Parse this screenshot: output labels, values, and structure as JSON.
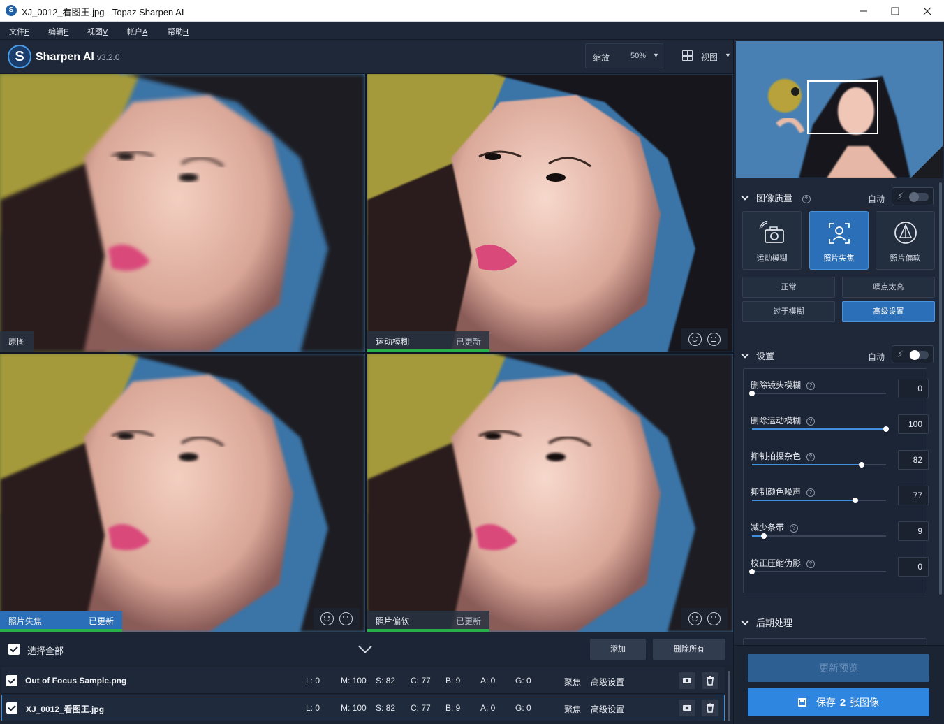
{
  "window": {
    "title": "XJ_0012_看图王.jpg - Topaz Sharpen AI"
  },
  "menu": [
    {
      "label": "文件",
      "key": "F"
    },
    {
      "label": "编辑",
      "key": "E"
    },
    {
      "label": "视图",
      "key": "V"
    },
    {
      "label": "帐户",
      "key": "A"
    },
    {
      "label": "帮助",
      "key": "H"
    }
  ],
  "brand": {
    "name": "Sharpen AI",
    "version": "v3.2.0"
  },
  "toolbar": {
    "zoom_label": "缩放",
    "zoom_value": "50%",
    "view_label": "视图"
  },
  "panes": {
    "original": "原图",
    "motion": {
      "label": "运动模糊",
      "status": "已更新"
    },
    "focus": {
      "label": "照片失焦",
      "status": "已更新"
    },
    "soft": {
      "label": "照片偏软",
      "status": "已更新"
    }
  },
  "queue": {
    "select_all": "选择全部",
    "add": "添加",
    "remove_all": "删除所有"
  },
  "files": [
    {
      "name": "Out of Focus Sample.png",
      "L": "L: 0",
      "M": "M: 100",
      "S": "S: 82",
      "C": "C: 77",
      "B": "B: 9",
      "A": "A: 0",
      "G": "G: 0",
      "mode": "聚焦",
      "preset": "高级设置"
    },
    {
      "name": "XJ_0012_看图王.jpg",
      "L": "L: 0",
      "M": "M: 100",
      "S": "S: 82",
      "C": "C: 77",
      "B": "B: 9",
      "A": "A: 0",
      "G": "G: 0",
      "mode": "聚焦",
      "preset": "高级设置"
    }
  ],
  "quality": {
    "title": "图像质量",
    "auto": "自动",
    "modes": [
      "运动模糊",
      "照片失焦",
      "照片偏软"
    ],
    "active_mode": "照片失焦",
    "types": [
      "正常",
      "噪点太高",
      "过于模糊",
      "高级设置"
    ],
    "active_type": "高级设置"
  },
  "settings": {
    "title": "设置",
    "auto": "自动",
    "sliders": [
      {
        "name": "删除镜头模糊",
        "value": 0,
        "display": "0"
      },
      {
        "name": "删除运动模糊",
        "value": 100,
        "display": "100"
      },
      {
        "name": "抑制拍摄杂色",
        "value": 82,
        "display": "82"
      },
      {
        "name": "抑制颜色噪声",
        "value": 77,
        "display": "77"
      },
      {
        "name": "减少条带",
        "value": 9,
        "display": "9"
      },
      {
        "name": "校正压缩伪影",
        "value": 0,
        "display": "0"
      }
    ]
  },
  "post": {
    "title": "后期处理"
  },
  "footer": {
    "update": "更新预览",
    "save_prefix": "保存",
    "save_count": "2",
    "save_suffix": "张图像"
  },
  "icons": {
    "close": "close-icon",
    "minimize": "minimize-icon",
    "maximize": "maximize-icon"
  },
  "colors": {
    "accent": "#2f86e0",
    "active": "#2a6fb7",
    "updated": "#27b04a"
  }
}
